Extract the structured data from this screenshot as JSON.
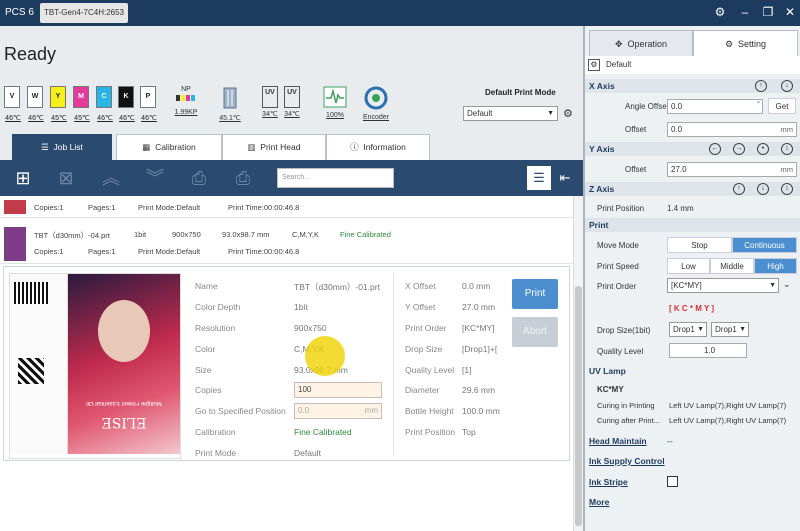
{
  "app": {
    "name": "PCS 6",
    "window_tab": "TBT-Gen4-7C4H:2653",
    "status": "Ready"
  },
  "inks": [
    {
      "code": "V",
      "temp": "46℃",
      "color": "#ffffff",
      "text": "#222"
    },
    {
      "code": "W",
      "temp": "46℃",
      "color": "#ffffff",
      "text": "#222"
    },
    {
      "code": "Y",
      "temp": "45℃",
      "color": "#f6ef1a",
      "text": "#222"
    },
    {
      "code": "M",
      "temp": "45℃",
      "color": "#e33a9c",
      "text": "#fff"
    },
    {
      "code": "C",
      "temp": "46℃",
      "color": "#27b5e6",
      "text": "#fff"
    },
    {
      "code": "K",
      "temp": "46℃",
      "color": "#111111",
      "text": "#fff"
    },
    {
      "code": "P",
      "temp": "46℃",
      "color": "#ffffff",
      "text": "#222"
    }
  ],
  "indicators": {
    "np": "NP",
    "np_value": "1.99KP",
    "board_temp": "45.1℃",
    "uv1": "UV",
    "uv1_temp": "34℃",
    "uv2": "UV",
    "uv2_temp": "34℃",
    "signal": "100%",
    "encoder": "Encoder"
  },
  "print_mode": {
    "label": "Default Print Mode",
    "value": "Default"
  },
  "tabs": [
    "Job List",
    "Calibration",
    "Print Head",
    "Information"
  ],
  "search": {
    "placeholder": "Search..."
  },
  "jobs": [
    {
      "copies": "Copies:1",
      "pages": "Pages:1",
      "mode": "Print Mode:Default",
      "time": "Print Time:00:00:46.8"
    },
    {
      "name": "TBT（d30mm）-04.prt",
      "bit": "1bit",
      "res": "900x750",
      "size": "93.0x98.7 mm",
      "color": "C,M,Y,K",
      "status": "Fine Calibrated",
      "copies": "Copies:1",
      "pages": "Pages:1",
      "mode": "Print Mode:Default",
      "time": "Print Time:00:00:46.8"
    }
  ],
  "detail": {
    "name_l": "Name",
    "name_v": "TBT（d30mm）-01.prt",
    "depth_l": "Color Depth",
    "depth_v": "1bit",
    "res_l": "Resolution",
    "res_v": "900x750",
    "color_l": "Color",
    "color_v": "C,M,Y,K",
    "size_l": "Size",
    "size_v": "93.0x98.7 mm",
    "copies_l": "Copies",
    "copies_v": "100",
    "goto_l": "Go to Specified Position",
    "goto_v": "0.0",
    "goto_unit": "mm",
    "calib_l": "Calibration",
    "calib_v": "Fine Calibrated",
    "mode_l": "Print Mode",
    "mode_v": "Default",
    "xoff_l": "X Offset",
    "xoff_v": "0.0 mm",
    "yoff_l": "Y Offset",
    "yoff_v": "27.0 mm",
    "order_l": "Print Order",
    "order_v": "[KC*MY]",
    "drop_l": "Drop Size",
    "drop_v": "[Drop1]+[",
    "ql_l": "Quality Level",
    "ql_v": "[1]",
    "dia_l": "Diameter",
    "dia_v": "29.6 mm",
    "bh_l": "Bottle Height",
    "bh_v": "100.0 mm",
    "pp_l": "Print Position",
    "pp_v": "Top",
    "print_btn": "Print",
    "abort_btn": "Abort",
    "thumb_title": "ELISE",
    "thumb_sub": "Multiple Flower Essential Oil"
  },
  "right": {
    "tab_operation": "Operation",
    "tab_setting": "Setting",
    "default": "Default",
    "x_axis": "X Axis",
    "angle_l": "Angle Offset",
    "angle_v": "0.0",
    "angle_unit": "°",
    "get": "Get",
    "xoff_l": "Offset",
    "xoff_v": "0.0",
    "xoff_unit": "mm",
    "y_axis": "Y Axis",
    "yoff_l": "Offset",
    "yoff_v": "27.0",
    "yoff_unit": "mm",
    "z_axis": "Z Axis",
    "zpos_l": "Print Position",
    "zpos_v": "1.4 mm",
    "print": "Print",
    "move_l": "Move Mode",
    "stop": "Stop",
    "continuous": "Continuous",
    "speed_l": "Print Speed",
    "low": "Low",
    "middle": "Middle",
    "high": "High",
    "order_l": "Print Order",
    "order_v": "[KC*MY]",
    "kcmy": "[ K C * M Y ]",
    "drop_l": "Drop Size(1bit)",
    "drop1": "Drop1",
    "drop2": "Drop1",
    "ql_l": "Quality Level",
    "ql_v": "1.0",
    "uv_lamp": "UV Lamp",
    "uv_kcmy": "KC*MY",
    "cip_l": "Curing in Printing",
    "cip_v": "Left UV Lamp(7),Right UV Lamp(7)",
    "cap_l": "Curing after Print...",
    "cap_v": "Left UV Lamp(7),Right UV Lamp(7)",
    "head_maintain": "Head Maintain",
    "dash": "--",
    "ink_supply": "Ink Supply Control",
    "ink_stripe": "Ink Stripe",
    "more": "More"
  }
}
